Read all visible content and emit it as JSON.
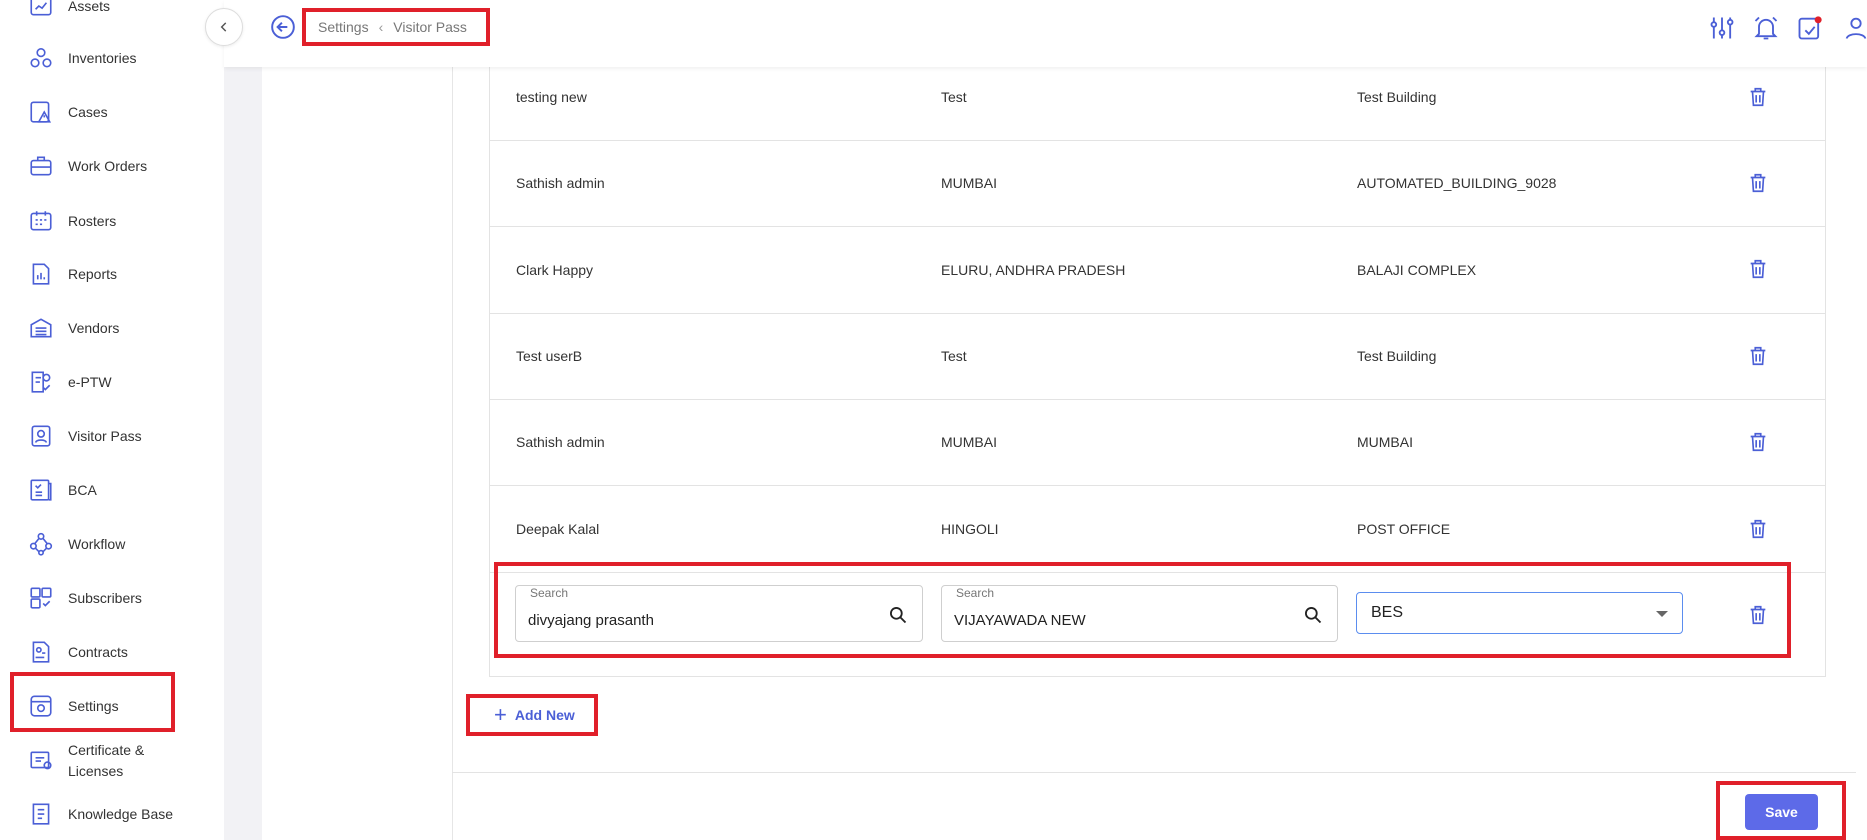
{
  "sidebar": {
    "items": [
      {
        "label": "Assets",
        "icon": "assets-icon"
      },
      {
        "label": "Inventories",
        "icon": "inventories-icon"
      },
      {
        "label": "Cases",
        "icon": "cases-icon"
      },
      {
        "label": "Work Orders",
        "icon": "work-orders-icon"
      },
      {
        "label": "Rosters",
        "icon": "rosters-icon"
      },
      {
        "label": "Reports",
        "icon": "reports-icon"
      },
      {
        "label": "Vendors",
        "icon": "vendors-icon"
      },
      {
        "label": "e-PTW",
        "icon": "eptw-icon"
      },
      {
        "label": "Visitor Pass",
        "icon": "visitor-pass-icon"
      },
      {
        "label": "BCA",
        "icon": "bca-icon"
      },
      {
        "label": "Workflow",
        "icon": "workflow-icon"
      },
      {
        "label": "Subscribers",
        "icon": "subscribers-icon"
      },
      {
        "label": "Contracts",
        "icon": "contracts-icon"
      },
      {
        "label": "Settings",
        "icon": "settings-icon"
      },
      {
        "label": "Certificate & Licenses",
        "icon": "certificate-icon"
      },
      {
        "label": "Knowledge Base",
        "icon": "knowledge-base-icon"
      }
    ]
  },
  "header": {
    "breadcrumb": {
      "parent": "Settings",
      "current": "Visitor Pass"
    }
  },
  "table": {
    "rows": [
      {
        "name": "testing new",
        "location": "Test",
        "building": "Test Building"
      },
      {
        "name": "Sathish admin",
        "location": "MUMBAI",
        "building": "AUTOMATED_BUILDING_9028"
      },
      {
        "name": "Clark Happy",
        "location": "ELURU, ANDHRA PRADESH",
        "building": "BALAJI COMPLEX"
      },
      {
        "name": "Test userB",
        "location": "Test",
        "building": "Test Building"
      },
      {
        "name": "Sathish admin",
        "location": "MUMBAI",
        "building": "MUMBAI"
      },
      {
        "name": "Deepak Kalal",
        "location": "HINGOLI",
        "building": "POST OFFICE"
      }
    ],
    "edit_row": {
      "user_label": "Search",
      "user_value": "divyajang prasanth",
      "location_label": "Search",
      "location_value": "VIJAYAWADA NEW",
      "building_value": "BES"
    }
  },
  "actions": {
    "add_new": "Add New",
    "save": "Save"
  },
  "colors": {
    "accent": "#5d6ae8",
    "highlight": "#e0202a",
    "icon": "#4b5fd6"
  }
}
